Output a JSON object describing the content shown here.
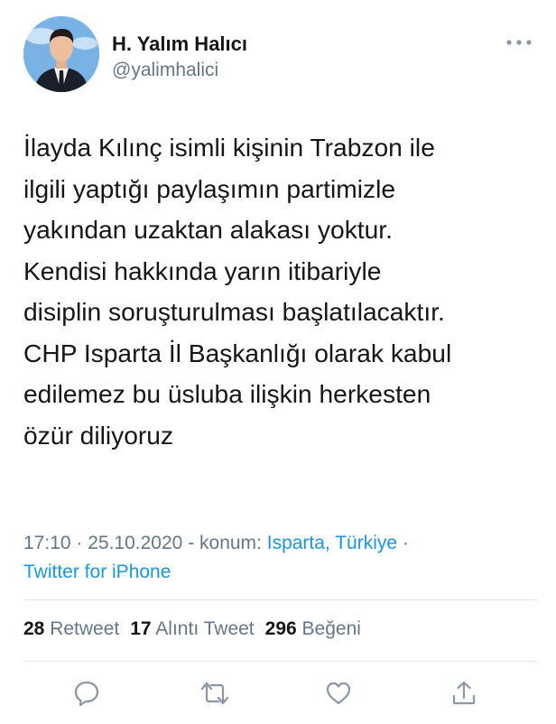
{
  "tweet": {
    "author": {
      "display_name": "H. Yalım Halıcı",
      "handle": "@yalimhalici"
    },
    "text_lines": [
      "İlayda Kılınç isimli kişinin Trabzon ile",
      "ilgili yaptığı paylaşımın partimizle",
      "yakından uzaktan alakası yoktur.",
      "Kendisi hakkında yarın itibariyle",
      "disiplin soruşturulması başlatılacaktır.",
      "CHP Isparta İl Başkanlığı olarak kabul",
      "edilemez bu üsluba ilişkin herkesten",
      "özür diliyoruz"
    ],
    "meta": {
      "time": "17:10",
      "date": "25.10.2020",
      "location_prefix": "konum:",
      "location": "Isparta, Türkiye",
      "source": "Twitter for iPhone"
    },
    "stats": {
      "retweets": "28",
      "retweets_label": "Retweet",
      "quotes": "17",
      "quotes_label": "Alıntı Tweet",
      "likes": "296",
      "likes_label": "Beğeni"
    }
  },
  "icons": {
    "more": "more-horizontal-icon",
    "reply": "reply-icon",
    "retweet": "retweet-icon",
    "like": "heart-icon",
    "share": "share-icon"
  },
  "colors": {
    "text": "#14171a",
    "secondary": "#657786",
    "link": "#1b95e0",
    "divider": "#e1e8ed"
  }
}
